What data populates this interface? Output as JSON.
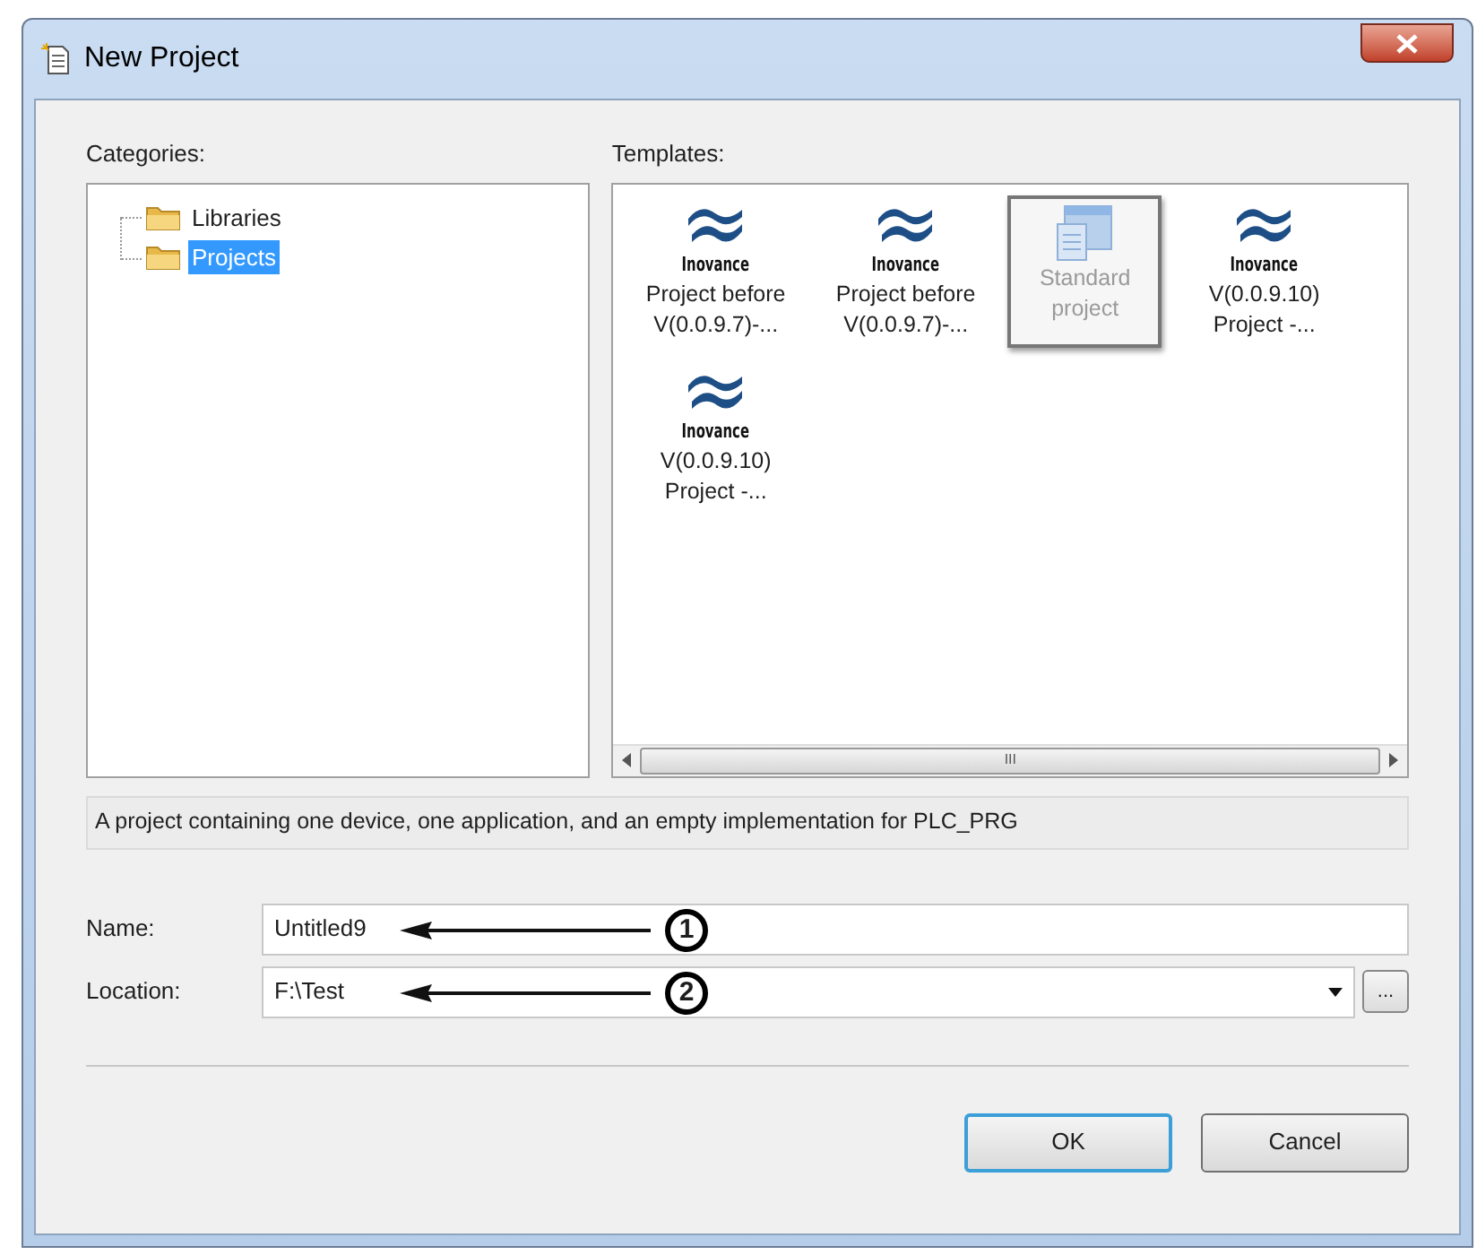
{
  "window": {
    "title": "New Project"
  },
  "categories": {
    "label": "Categories:",
    "items": [
      {
        "label": "Libraries",
        "selected": false
      },
      {
        "label": "Projects",
        "selected": true
      }
    ]
  },
  "templates": {
    "label": "Templates:",
    "items": [
      {
        "kind": "logo",
        "brand": "Inovance",
        "lines": [
          "Project before",
          "V(0.0.9.7)-..."
        ],
        "selected": false
      },
      {
        "kind": "logo",
        "brand": "Inovance",
        "lines": [
          "Project before",
          "V(0.0.9.7)-..."
        ],
        "selected": false
      },
      {
        "kind": "standard",
        "lines": [
          "Standard",
          "project"
        ],
        "selected": true
      },
      {
        "kind": "logo",
        "brand": "Inovance",
        "lines": [
          "V(0.0.9.10)",
          "Project -..."
        ],
        "selected": false
      },
      {
        "kind": "logo",
        "brand": "Inovance",
        "lines": [
          "V(0.0.9.10)",
          "Project -..."
        ],
        "selected": false
      }
    ],
    "scrollbar_grip": "III"
  },
  "description": "A project containing one device, one application, and an empty implementation for PLC_PRG",
  "fields": [
    {
      "kind": "text",
      "label": "Name:",
      "value": "Untitled9",
      "annotation": "1"
    },
    {
      "kind": "combo",
      "label": "Location:",
      "value": "F:\\Test",
      "annotation": "2",
      "browse": "..."
    }
  ],
  "buttons": [
    {
      "label": "OK",
      "default": true
    },
    {
      "label": "Cancel",
      "default": false
    }
  ]
}
